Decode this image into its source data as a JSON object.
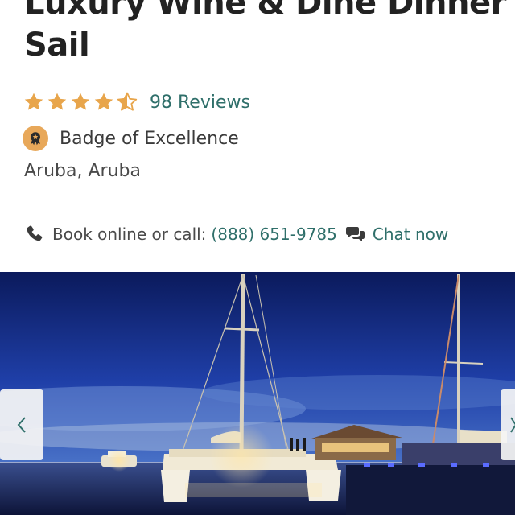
{
  "listing": {
    "title": "Luxury Wine & Dine Dinner Sail",
    "rating": {
      "value": 4.5,
      "max": 5,
      "reviews_label": "98 Reviews"
    },
    "badge": {
      "label": "Badge of Excellence",
      "icon": "award-badge-icon"
    },
    "location": "Aruba, Aruba"
  },
  "contact": {
    "book_label": "Book online or call:",
    "phone": "(888) 651-9785",
    "chat_label": "Chat now",
    "phone_icon": "phone-icon",
    "chat_icon": "chat-bubbles-icon"
  },
  "gallery": {
    "prev_icon": "chevron-left-icon",
    "next_icon": "chevron-right-icon"
  },
  "colors": {
    "accent": "#2f6f6a",
    "star": "#e8a54b",
    "badge": "#e8a85a",
    "text": "#3b3b3b"
  }
}
